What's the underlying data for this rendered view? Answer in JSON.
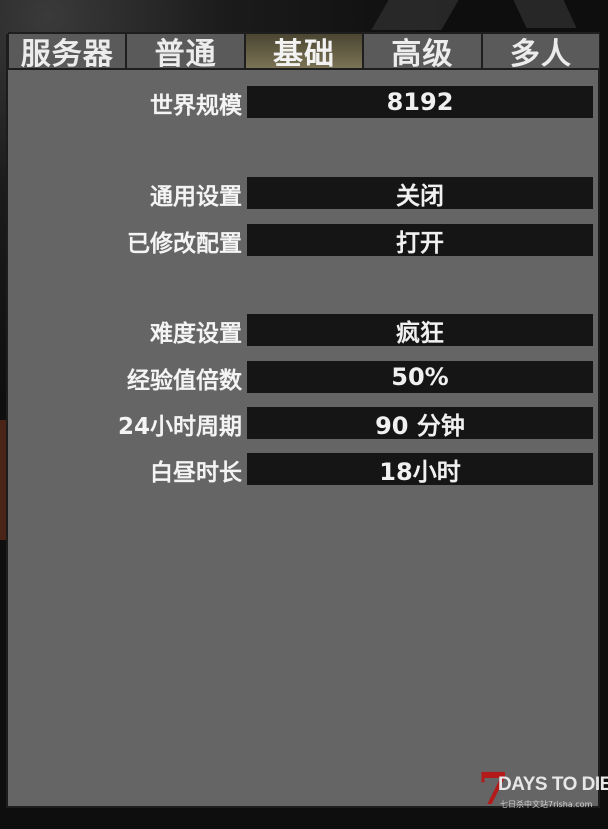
{
  "tabs": [
    {
      "label": "服务器",
      "active": false
    },
    {
      "label": "普通",
      "active": false
    },
    {
      "label": "基础",
      "active": true
    },
    {
      "label": "高级",
      "active": false
    },
    {
      "label": "多人",
      "active": false
    }
  ],
  "settings": [
    {
      "label": "世界规模",
      "value": "8192"
    },
    {
      "label": "通用设置",
      "value": "关闭"
    },
    {
      "label": "已修改配置",
      "value": "打开"
    },
    {
      "label": "难度设置",
      "value": "疯狂"
    },
    {
      "label": "经验值倍数",
      "value": "50%"
    },
    {
      "label": "24小时周期",
      "value": "90 分钟"
    },
    {
      "label": "白昼时长",
      "value": "18小时"
    }
  ],
  "watermark": {
    "seven": "7",
    "title": "DAYS TO DIE",
    "sub": "七日杀中文站7risha.com"
  },
  "colors": {
    "panel": "#656565",
    "value_box": "#151515",
    "active_tab": "#7b7354",
    "logo_red": "#b51a1a"
  }
}
